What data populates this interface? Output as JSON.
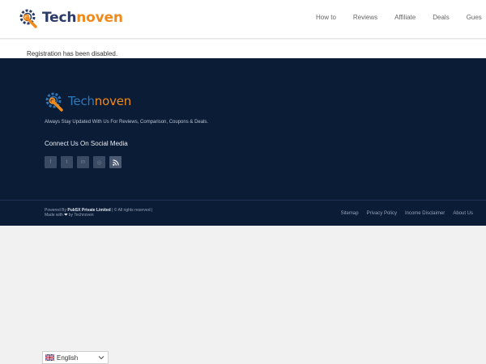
{
  "header": {
    "logo_tech": "Tech",
    "logo_noven": "noven",
    "nav": [
      "How to",
      "Reviews",
      "Affiliate",
      "Deals",
      "Gues"
    ]
  },
  "notice": "Registration has been disabled.",
  "footer": {
    "logo_tech": "Tech",
    "logo_noven": "noven",
    "tagline": "Always Stay Updated With Us For Reviews, Comparison, Coupons & Deals.",
    "connect_heading": "Connect Us On Social Media",
    "social_icons": [
      "facebook-icon",
      "twitter-icon",
      "linkedin-icon",
      "instagram-icon",
      "rss-icon"
    ],
    "credits_prefix": "Powered By",
    "credits_company": "PubSX Private Limited",
    "credits_suffix": "| © All rights reserved |",
    "made_with_prefix": "Made with",
    "made_with_suffix": "by Technoven",
    "bottom_links": [
      "Sitemap",
      "Privacy Policy",
      "Income Disclaimer",
      "About Us"
    ]
  },
  "language": {
    "selected": "English"
  },
  "colors": {
    "brand_blue": "#2b3a66",
    "brand_orange": "#f08a1d",
    "footer_bg": "#0a1c36"
  }
}
